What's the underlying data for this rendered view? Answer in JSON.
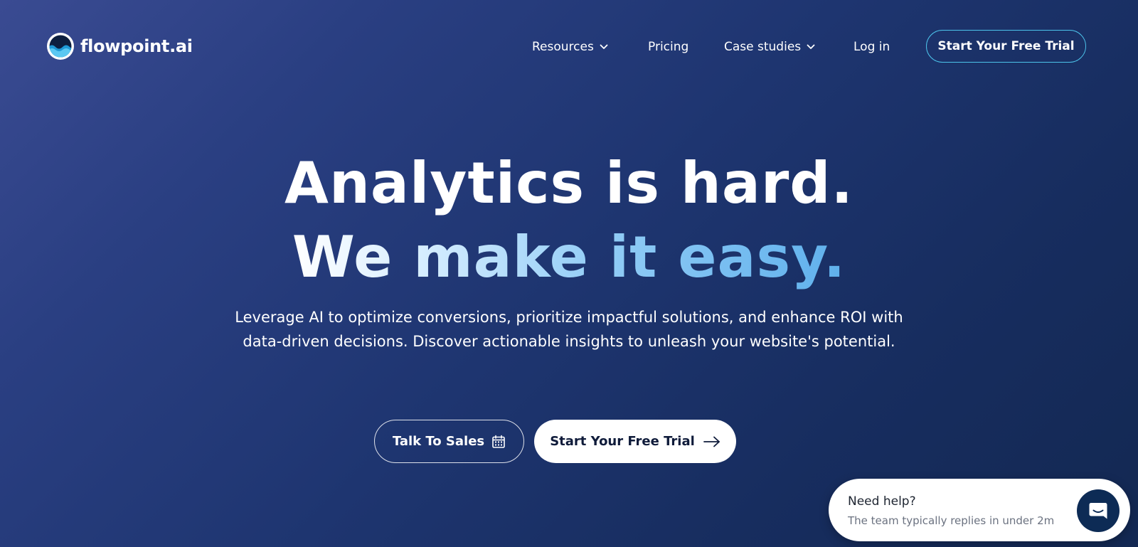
{
  "brand": {
    "name": "flowpoint.ai",
    "icon": "flowpoint-wave-logo",
    "colors": {
      "background_start": "#3a4b92",
      "background_end": "#132852",
      "accent_border": "#4cc3ea",
      "highlight_blue": "#5fb0ec",
      "chat_button": "#0d2b55"
    }
  },
  "nav": {
    "items": [
      {
        "label": "Resources",
        "has_dropdown": true
      },
      {
        "label": "Pricing",
        "has_dropdown": false
      },
      {
        "label": "Case studies",
        "has_dropdown": true
      },
      {
        "label": "Log in",
        "has_dropdown": false
      }
    ],
    "cta_label": "Start Your Free Trial"
  },
  "hero": {
    "headline_line1": "Analytics is hard.",
    "headline_line2": "We make it easy.",
    "subheadline": "Leverage AI to optimize conversions, prioritize impactful solutions, and enhance ROI with data-driven decisions. Discover actionable insights to unleash your website's potential."
  },
  "cta": {
    "sales_label": "Talk To Sales",
    "sales_icon": "calendar-icon",
    "trial_label": "Start Your Free Trial",
    "trial_icon": "arrow-right-icon"
  },
  "chat": {
    "title": "Need help?",
    "subtitle": "The team typically replies in under 2m",
    "icon": "chat-bubble-icon"
  }
}
